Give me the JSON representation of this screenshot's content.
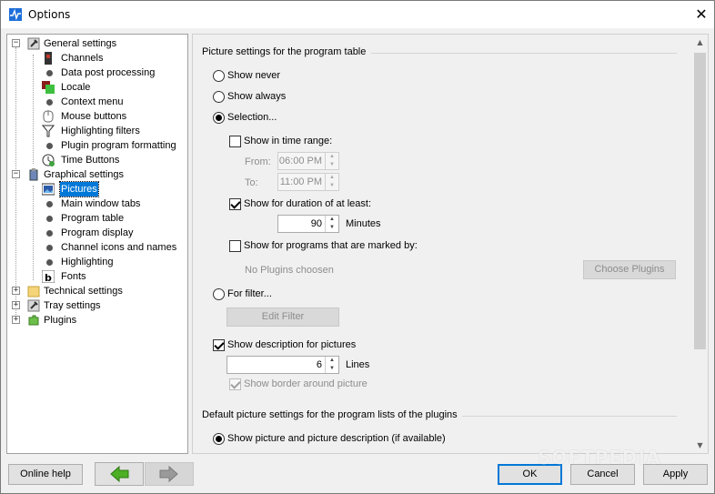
{
  "window": {
    "title": "Options",
    "close_glyph": "✕"
  },
  "tree": {
    "items": [
      {
        "label": "General settings",
        "icon": "wrench-icon"
      },
      {
        "label": "Channels",
        "icon": "channels-icon"
      },
      {
        "label": "Data post processing",
        "icon": "bullet"
      },
      {
        "label": "Locale",
        "icon": "locale-icon"
      },
      {
        "label": "Context menu",
        "icon": "bullet"
      },
      {
        "label": "Mouse buttons",
        "icon": "mouse-icon"
      },
      {
        "label": "Highlighting filters",
        "icon": "filter-icon"
      },
      {
        "label": "Plugin program formatting",
        "icon": "bullet"
      },
      {
        "label": "Time Buttons",
        "icon": "clock-icon"
      },
      {
        "label": "Graphical settings",
        "icon": "paint-icon"
      },
      {
        "label": "Pictures",
        "icon": "picture-icon"
      },
      {
        "label": "Main window tabs",
        "icon": "bullet"
      },
      {
        "label": "Program table",
        "icon": "bullet"
      },
      {
        "label": "Program display",
        "icon": "bullet"
      },
      {
        "label": "Channel icons and names",
        "icon": "bullet"
      },
      {
        "label": "Highlighting",
        "icon": "bullet"
      },
      {
        "label": "Fonts",
        "icon": "font-icon"
      },
      {
        "label": "Technical settings",
        "icon": "folder-icon"
      },
      {
        "label": "Tray settings",
        "icon": "wrench-icon"
      },
      {
        "label": "Plugins",
        "icon": "plugin-icon"
      }
    ],
    "selected": "Pictures"
  },
  "panel": {
    "section1_title": "Picture settings for the program table",
    "show_never": "Show never",
    "show_always": "Show always",
    "selection": "Selection...",
    "show_in_time_range": "Show in time range:",
    "from_label": "From:",
    "from_value": "06:00 PM",
    "to_label": "To:",
    "to_value": "11:00 PM",
    "show_for_duration": "Show for duration of at least:",
    "duration_value": "90",
    "minutes_label": "Minutes",
    "show_marked_by": "Show for programs that are marked by:",
    "no_plugins": "No Plugins choosen",
    "choose_plugins": "Choose Plugins",
    "for_filter": "For filter...",
    "edit_filter": "Edit Filter",
    "show_description": "Show description for pictures",
    "lines_value": "6",
    "lines_label": "Lines",
    "show_border": "Show border around picture",
    "section2_title": "Default picture settings for the program lists of the plugins",
    "show_picture_desc": "Show picture and picture description (if available)"
  },
  "buttons": {
    "online_help": "Online help",
    "ok": "OK",
    "cancel": "Cancel",
    "apply": "Apply"
  },
  "watermark": "SOFTPEDIA",
  "colors": {
    "selection": "#0078d7",
    "back_arrow": "#4caf24",
    "forward_arrow": "#9a9a9a"
  }
}
